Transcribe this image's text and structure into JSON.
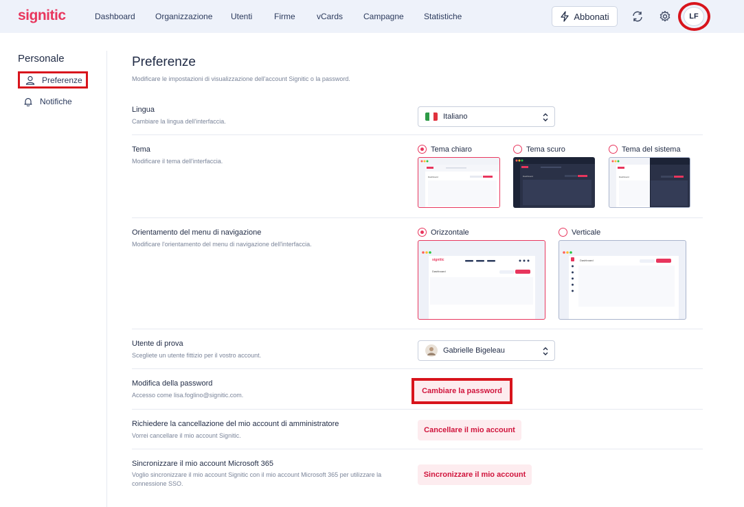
{
  "app": {
    "logo": "signitic",
    "accent": "#e8365d"
  },
  "nav": {
    "items": [
      "Dashboard",
      "Organizzazione",
      "Utenti",
      "Firme",
      "vCards",
      "Campagne",
      "Statistiche"
    ],
    "subscribe_label": "Abbonati",
    "avatar_initials": "LF"
  },
  "sidebar": {
    "title": "Personale",
    "items": [
      {
        "label": "Preferenze",
        "icon": "user-icon",
        "active": true
      },
      {
        "label": "Notifiche",
        "icon": "bell-icon",
        "active": false
      }
    ]
  },
  "page": {
    "title": "Preferenze",
    "subtitle": "Modificare le impostazioni di visualizzazione dell'account Signitic o la password."
  },
  "language": {
    "label": "Lingua",
    "description": "Cambiare la lingua dell'interfaccia.",
    "value": "Italiano"
  },
  "theme": {
    "label": "Tema",
    "description": "Modificare il tema dell'interfaccia.",
    "options": [
      {
        "label": "Tema chiaro",
        "selected": true
      },
      {
        "label": "Tema scuro",
        "selected": false
      },
      {
        "label": "Tema del sistema",
        "selected": false
      }
    ],
    "thumb_text": "Dashboard"
  },
  "orientation": {
    "label": "Orientamento del menu di navigazione",
    "description": "Modificare l'orientamento del menu di navigazione dell'interfaccia.",
    "options": [
      {
        "label": "Orizzontale",
        "selected": true
      },
      {
        "label": "Verticale",
        "selected": false
      }
    ],
    "thumb_logo": "signitic",
    "thumb_text": "Dashboard"
  },
  "test_user": {
    "label": "Utente di prova",
    "description": "Scegliete un utente fittizio per il vostro account.",
    "value": "Gabrielle Bigeleau"
  },
  "password": {
    "label": "Modifica della password",
    "description": "Accesso come lisa.foglino@signitic.com.",
    "button": "Cambiare la password"
  },
  "delete_account": {
    "label": "Richiedere la cancellazione del mio account di amministratore",
    "description": "Vorrei cancellare il mio account Signitic.",
    "button": "Cancellare il mio account"
  },
  "microsoft": {
    "label": "Sincronizzare il mio account Microsoft 365",
    "description": "Voglio sincronizzare il mio account Signitic con il mio account Microsoft 365 per utilizzare la connessione SSO.",
    "button": "Sincronizzare il mio account"
  }
}
